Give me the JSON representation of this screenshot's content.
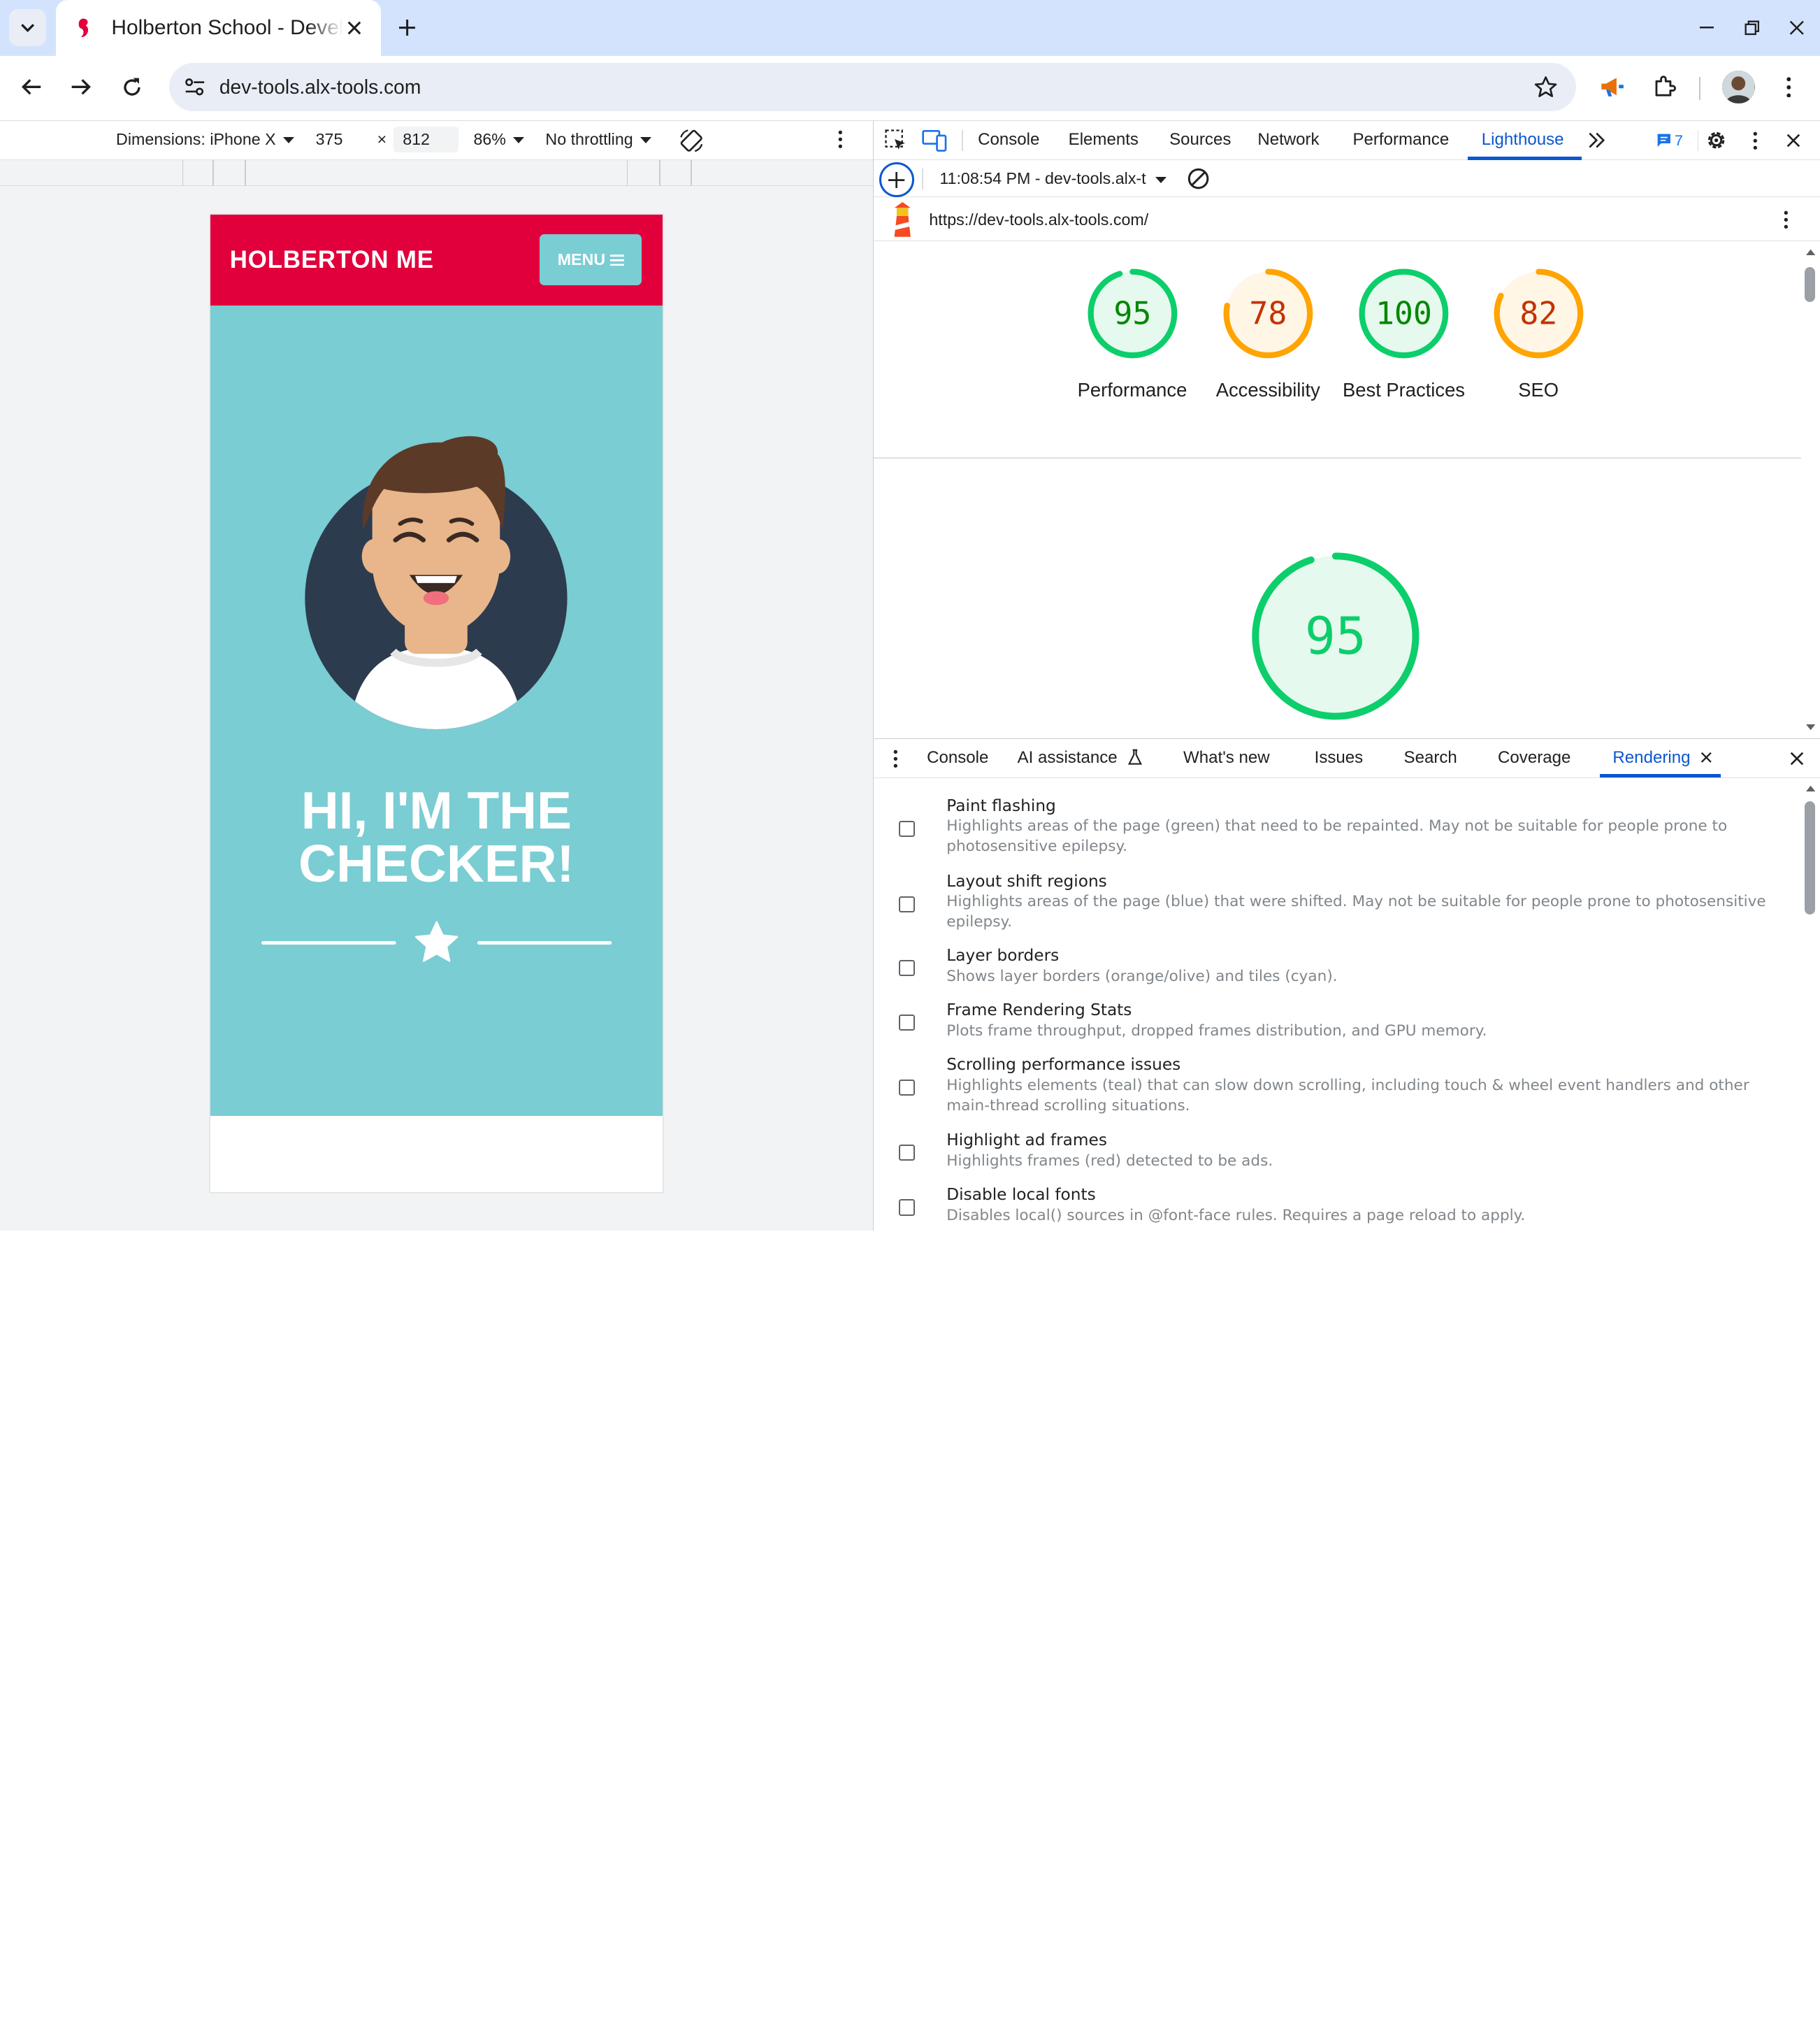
{
  "browser": {
    "tab_title": "Holberton School - Developer",
    "url": "dev-tools.alx-tools.com"
  },
  "device_toolbar": {
    "dimensions_label": "Dimensions: iPhone X",
    "width": "375",
    "times": "×",
    "height": "812",
    "zoom": "86%",
    "throttling": "No throttling"
  },
  "site": {
    "logo": "HOLBERTON ME",
    "menu_label": "MENU",
    "hero_line1": "HI, I'M THE",
    "hero_line2": "CHECKER!",
    "colors": {
      "header": "#e1003c",
      "hero": "#79cdd3"
    }
  },
  "devtools": {
    "tabs": [
      "Console",
      "Elements",
      "Sources",
      "Network",
      "Performance",
      "Lighthouse"
    ],
    "active_tab": "Lighthouse",
    "issues_count": "7",
    "report_selector": "11:08:54 PM - dev-tools.alx-t",
    "report_url": "https://dev-tools.alx-tools.com/",
    "scores": [
      {
        "value": 95,
        "label": "Performance",
        "color": "#0cce6b"
      },
      {
        "value": 78,
        "label": "Accessibility",
        "color": "#ffa400"
      },
      {
        "value": 100,
        "label": "Best Practices",
        "color": "#0cce6b"
      },
      {
        "value": 82,
        "label": "SEO",
        "color": "#ffa400"
      }
    ],
    "main_score": 95
  },
  "drawer": {
    "tabs": [
      "Console",
      "AI assistance",
      "What's new",
      "Issues",
      "Search",
      "Coverage",
      "Rendering"
    ],
    "active_tab": "Rendering",
    "rendering_items": [
      {
        "title": "Paint flashing",
        "desc": "Highlights areas of the page (green) that need to be repainted. May not be suitable for people prone to photosensitive epilepsy."
      },
      {
        "title": "Layout shift regions",
        "desc": "Highlights areas of the page (blue) that were shifted. May not be suitable for people prone to photosensitive epilepsy."
      },
      {
        "title": "Layer borders",
        "desc": "Shows layer borders (orange/olive) and tiles (cyan)."
      },
      {
        "title": "Frame Rendering Stats",
        "desc": "Plots frame throughput, dropped frames distribution, and GPU memory."
      },
      {
        "title": "Scrolling performance issues",
        "desc": "Highlights elements (teal) that can slow down scrolling, including touch & wheel event handlers and other main-thread scrolling situations."
      },
      {
        "title": "Highlight ad frames",
        "desc": "Highlights frames (red) detected to be ads."
      },
      {
        "title": "Disable local fonts",
        "desc": "Disables local() sources in @font-face rules. Requires a page reload to apply."
      }
    ]
  }
}
